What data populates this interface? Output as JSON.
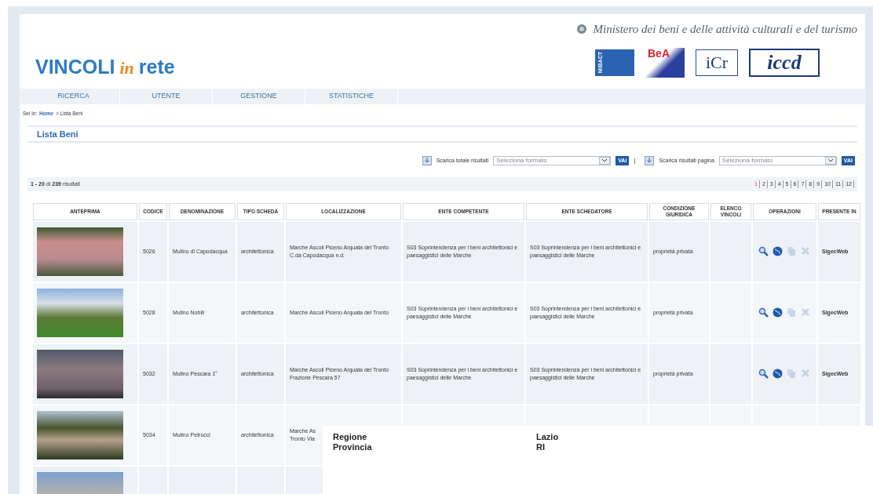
{
  "header": {
    "ministry": "Ministero dei beni e delle attività culturali e del turismo",
    "title_main": "VINCOLI",
    "title_in": "in",
    "title_end": "rete",
    "logos": [
      {
        "kind": "mibact",
        "text": "MiBACT"
      },
      {
        "kind": "beap",
        "text": "BeA"
      },
      {
        "kind": "icr",
        "text": "iCr"
      },
      {
        "kind": "iccd",
        "text": "iccd"
      }
    ]
  },
  "nav": [
    {
      "label": "RICERCA",
      "selected": false
    },
    {
      "label": "UTENTE",
      "selected": false
    },
    {
      "label": "GESTIONE",
      "selected": false
    },
    {
      "label": "STATISTICHE",
      "selected": false
    }
  ],
  "breadcrumb": {
    "prefix": "Sei in:",
    "link": "Home",
    "current": "> Lista Beni"
  },
  "section_title": "Lista Beni",
  "downloads": [
    {
      "label": "Scarica totale risultati",
      "placeholder": "Seleziona formato",
      "button": "VAI",
      "separator": "|"
    },
    {
      "label": "Scarica risultati pagina",
      "placeholder": "Seleziona formato",
      "button": "VAI"
    }
  ],
  "result_count": "**1 - 20** di **239** risultati",
  "pagination": [
    {
      "label": "1",
      "selected": true
    },
    {
      "label": "2",
      "selected": false
    },
    {
      "label": "3",
      "selected": false
    },
    {
      "label": "4",
      "selected": false
    },
    {
      "label": "5",
      "selected": false
    },
    {
      "label": "6",
      "selected": false
    },
    {
      "label": "7",
      "selected": false
    },
    {
      "label": "8",
      "selected": false
    },
    {
      "label": "9",
      "selected": false
    },
    {
      "label": "10",
      "selected": false
    },
    {
      "label": "11",
      "selected": false
    },
    {
      "label": "12",
      "selected": false
    }
  ],
  "table": {
    "columns": [
      "ANTEPRIMA",
      "CODICE",
      "DENOMINAZIONE",
      "TIPO SCHEDA",
      "LOCALIZZAZIONE",
      "ENTE COMPETENTE",
      "ENTE SCHEDATORE",
      "CONDIZIONE GIURIDICA",
      "ELENCO VINCOLI",
      "OPERAZIONI",
      "PRESENTE IN"
    ],
    "rows": [
      {
        "codice": "5026",
        "denominazione": "Mulino di Capodacqua",
        "tipo": "architettonica",
        "localizzazione": "Marche Ascoli Piceno Arquata del Tronto C.da Capodacqua n.d.",
        "ente_competente": "S03 Soprintendenza per i beni architettonici e paesaggistici delle Marche",
        "ente_schedatore": "S03 Soprintendenza per i beni architettonici e paesaggistici delle Marche",
        "condizione": "proprietà privata",
        "operations": [
          {
            "kind": "search",
            "disabled": false
          },
          {
            "kind": "globe",
            "disabled": false
          },
          {
            "kind": "copy",
            "disabled": true
          },
          {
            "kind": "delete",
            "disabled": true
          }
        ],
        "presente": "SigecWeb"
      },
      {
        "codice": "5028",
        "denominazione": "Mulino Nobili",
        "tipo": "architettonica",
        "localizzazione": "Marche Ascoli Piceno Arquata del Tronto",
        "ente_competente": "S03 Soprintendenza per i beni architettonici e paesaggistici delle Marche",
        "ente_schedatore": "S03 Soprintendenza per i beni architettonici e paesaggistici delle Marche",
        "condizione": "proprietà privata",
        "operations": [
          {
            "kind": "search",
            "disabled": false
          },
          {
            "kind": "globe",
            "disabled": false
          },
          {
            "kind": "copy",
            "disabled": true
          },
          {
            "kind": "delete",
            "disabled": true
          }
        ],
        "presente": "SigecWeb"
      },
      {
        "codice": "5032",
        "denominazione": "Mulino Pescara 1°",
        "tipo": "architettonica",
        "localizzazione": "Marche Ascoli Piceno Arquata del Tronto Frazione Pescara 57",
        "ente_competente": "S03 Soprintendenza per i beni architettonici e paesaggistici delle Marche",
        "ente_schedatore": "S03 Soprintendenza per i beni architettonici e paesaggistici delle Marche",
        "condizione": "proprietà privata",
        "operations": [
          {
            "kind": "search",
            "disabled": false
          },
          {
            "kind": "globe",
            "disabled": false
          },
          {
            "kind": "copy",
            "disabled": true
          },
          {
            "kind": "delete",
            "disabled": true
          }
        ],
        "presente": "SigecWeb"
      },
      {
        "codice": "5034",
        "denominazione": "Mulino Petrucci",
        "tipo": "architettonica",
        "localizzazione": "Marche As\nTronto Via"
      },
      {}
    ]
  },
  "popup": {
    "rows": [
      {
        "label": "Regione",
        "value": "Lazio"
      },
      {
        "label": "Provincia",
        "value": "RI"
      }
    ]
  }
}
